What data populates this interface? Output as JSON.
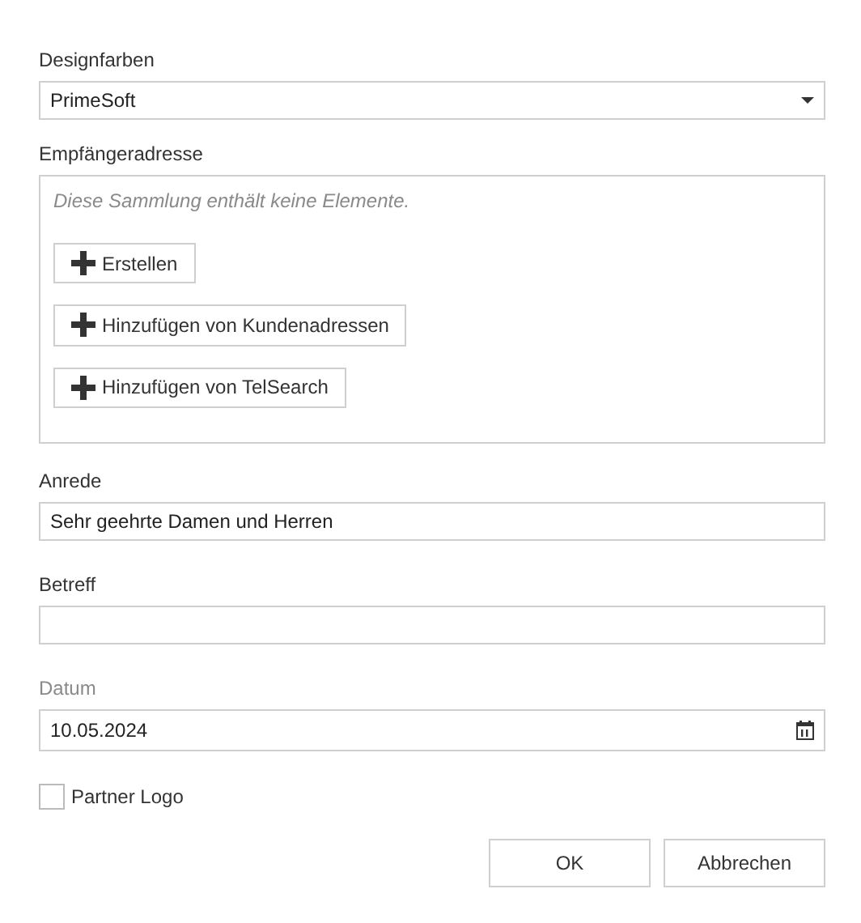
{
  "design_colors": {
    "label": "Designfarben",
    "value": "PrimeSoft"
  },
  "recipient": {
    "label": "Empfängeradresse",
    "empty_message": "Diese Sammlung enthält keine Elemente.",
    "buttons": [
      "Erstellen",
      "Hinzufügen von Kundenadressen",
      "Hinzufügen von TelSearch"
    ]
  },
  "fields": [
    {
      "kind": "text",
      "label": "Anrede",
      "value": "Sehr geehrte Damen und Herren",
      "dimmed": false
    },
    {
      "kind": "text",
      "label": "Betreff",
      "dimmed": false
    },
    {
      "kind": "date",
      "label": "Datum",
      "value": "10.05.2024",
      "dimmed": true
    }
  ],
  "partner_logo": {
    "label": "Partner Logo",
    "checked": false
  },
  "buttons": [
    "OK",
    "Abbrechen"
  ]
}
